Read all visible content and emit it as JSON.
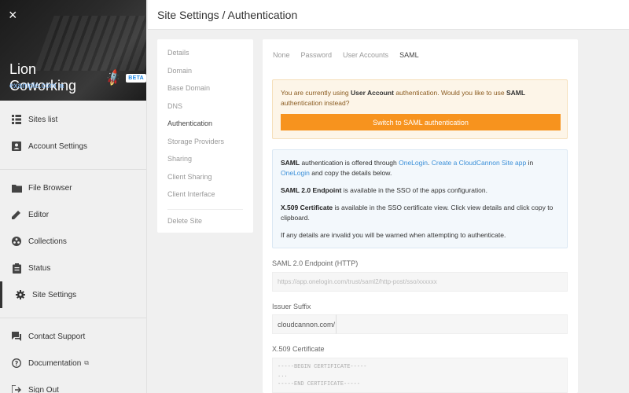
{
  "sidebar": {
    "close_icon": "×",
    "site_name": "Lion Coworking",
    "badge": "BETA",
    "site_url": "example.com",
    "groups": [
      [
        {
          "label": "Sites list",
          "icon": "grid-icon"
        },
        {
          "label": "Account Settings",
          "icon": "account-icon"
        }
      ],
      [
        {
          "label": "File Browser",
          "icon": "folder-icon"
        },
        {
          "label": "Editor",
          "icon": "pencil-icon"
        },
        {
          "label": "Collections",
          "icon": "collections-icon"
        },
        {
          "label": "Status",
          "icon": "clipboard-icon"
        },
        {
          "label": "Site Settings",
          "icon": "gear-icon",
          "active": true
        }
      ],
      [
        {
          "label": "Contact Support",
          "icon": "chat-icon"
        },
        {
          "label": "Documentation",
          "icon": "help-icon",
          "external": true
        },
        {
          "label": "Sign Out",
          "icon": "signout-icon"
        }
      ]
    ]
  },
  "header": {
    "title": "Site Settings / Authentication"
  },
  "settings_menu": {
    "items": [
      "Details",
      "Domain",
      "Base Domain",
      "DNS",
      "Authentication",
      "Storage Providers",
      "Sharing",
      "Client Sharing",
      "Client Interface"
    ],
    "active": "Authentication",
    "delete_label": "Delete Site"
  },
  "auth": {
    "tabs": [
      "None",
      "Password",
      "User Accounts",
      "SAML"
    ],
    "active_tab": "SAML",
    "notice": {
      "text_1": "You are currently using ",
      "bold_1": "User Account",
      "text_2": " authentication. Would you like to use ",
      "bold_2": "SAML",
      "text_3": " authentication instead?",
      "button": "Switch to SAML authentication"
    },
    "info": {
      "p1_bold": "SAML",
      "p1_text_1": " authentication is offered through ",
      "p1_link_1": "OneLogin",
      "p1_text_2": ". ",
      "p1_link_2": "Create a CloudCannon Site app",
      "p1_text_3": " in ",
      "p1_link_3": "OneLogin",
      "p1_text_4": " and copy the details below.",
      "p2_bold": "SAML 2.0 Endpoint",
      "p2_text": " is available in the SSO of the apps configuration.",
      "p3_bold": "X.509 Certificate",
      "p3_text": " is available in the SSO certificate view. Click view details and click copy to clipboard.",
      "p4_text": "If any details are invalid you will be warned when attempting to authenticate."
    },
    "endpoint_label": "SAML 2.0 Endpoint (HTTP)",
    "endpoint_placeholder": "https://app.onelogin.com/trust/saml2/http-post/sso/xxxxxx",
    "issuer_label": "Issuer Suffix",
    "issuer_prefix": "cloudcannon.com/",
    "cert_label": "X.509 Certificate",
    "cert_placeholder": "-----BEGIN CERTIFICATE-----\n...\n-----END CERTIFICATE-----"
  },
  "colors": {
    "accent_orange": "#f7931e",
    "link_blue": "#3a8fd8",
    "badge_blue": "#1e88e5"
  }
}
